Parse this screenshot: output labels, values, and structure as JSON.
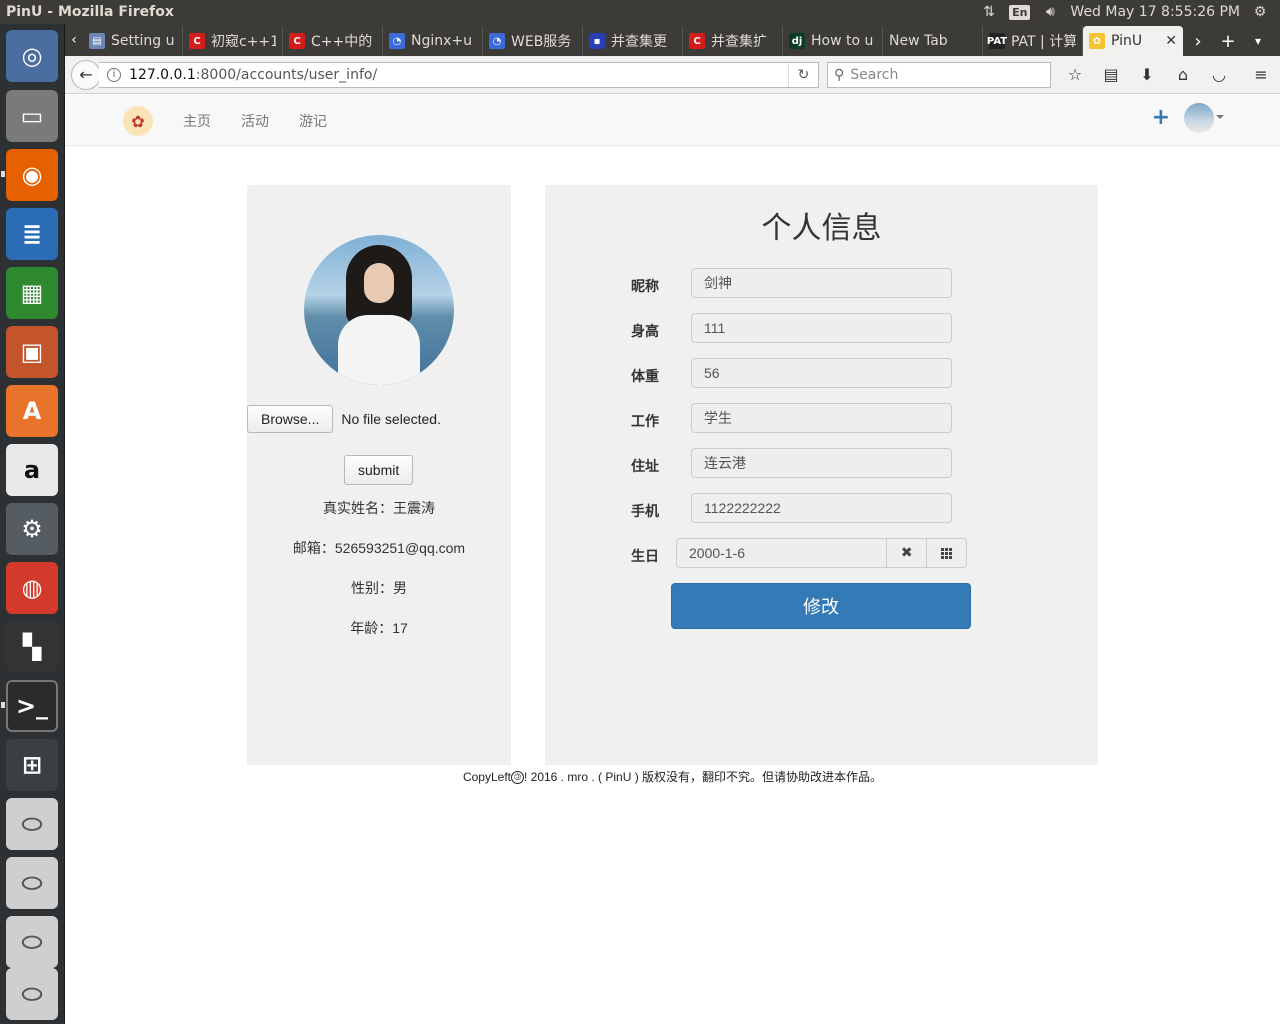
{
  "window": {
    "title": "PinU - Mozilla Firefox",
    "lang": "En",
    "clock": "Wed May 17  8:55:26 PM"
  },
  "tabs": [
    {
      "label": "Setting u",
      "favicon": "settings-icon"
    },
    {
      "label": "初窥c++1",
      "favicon": "c-icon"
    },
    {
      "label": "C++中的",
      "favicon": "c-icon"
    },
    {
      "label": "Nginx+u",
      "favicon": "globe-icon"
    },
    {
      "label": "WEB服务",
      "favicon": "globe-icon"
    },
    {
      "label": "并查集更",
      "favicon": "image-icon"
    },
    {
      "label": "并查集扩",
      "favicon": "c-icon"
    },
    {
      "label": "How to u",
      "favicon": "django-icon"
    },
    {
      "label": "New Tab",
      "favicon": ""
    },
    {
      "label": "PAT | 计算",
      "favicon": "pat-icon"
    },
    {
      "label": "PinU",
      "favicon": "pinu-icon",
      "active": true
    }
  ],
  "urlbar": {
    "host": "127.0.0.1",
    "path": ":8000/accounts/user_info/"
  },
  "search": {
    "placeholder": "Search"
  },
  "site_nav": {
    "links": [
      "主页",
      "活动",
      "游记"
    ]
  },
  "profile": {
    "browse_label": "Browse...",
    "file_status": "No file selected.",
    "submit_label": "submit",
    "real_name": "真实姓名：王震涛",
    "email": "邮箱：526593251@qq.com",
    "gender": "性别：男",
    "age": "年龄：17"
  },
  "form": {
    "title": "个人信息",
    "fields": [
      {
        "label": "昵称",
        "value": "剑神"
      },
      {
        "label": "身高",
        "value": "111"
      },
      {
        "label": "体重",
        "value": "56"
      },
      {
        "label": "工作",
        "value": "学生"
      },
      {
        "label": "住址",
        "value": "连云港"
      },
      {
        "label": "手机",
        "value": "1122222222"
      }
    ],
    "birthday_label": "生日",
    "birthday_value": "2000-1-6",
    "submit_label": "修改"
  },
  "footer": {
    "before": "CopyLeft",
    "after": "! 2016 . mro . ( PinU ) 版权没有，翻印不究。但请协助改进本作品。"
  },
  "colors": {
    "primary": "#337ab7",
    "panel": "#f0f0f0",
    "ubuntu_panel": "#3c3b37"
  }
}
